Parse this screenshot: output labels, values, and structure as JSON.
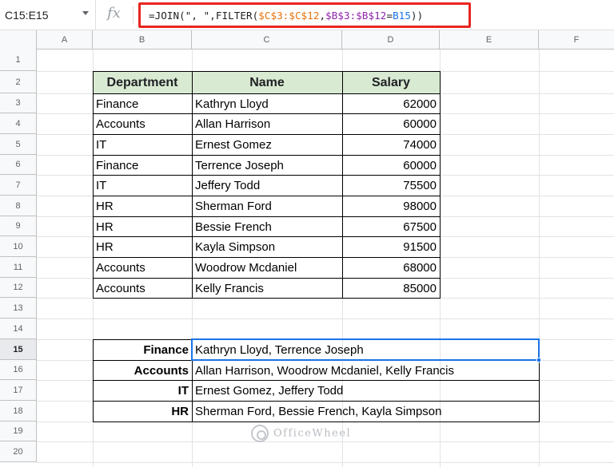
{
  "name_box": "C15:E15",
  "fx_symbol": "fx",
  "formula": {
    "p1": "=JOIN(\", \",FILTER(",
    "r1": "$C$3:$C$12",
    "p2": ",",
    "r2": "$B$3:$B$12",
    "p3": "=",
    "r3": "B15",
    "p4": "))"
  },
  "columns": [
    "A",
    "B",
    "C",
    "D",
    "E",
    "F"
  ],
  "rows": [
    "1",
    "2",
    "3",
    "4",
    "5",
    "6",
    "7",
    "8",
    "9",
    "10",
    "11",
    "12",
    "13",
    "14",
    "15",
    "16",
    "17",
    "18",
    "19",
    "20"
  ],
  "table1": {
    "headers": [
      "Department",
      "Name",
      "Salary"
    ],
    "rows": [
      [
        "Finance",
        "Kathryn Lloyd",
        "62000"
      ],
      [
        "Accounts",
        "Allan Harrison",
        "60000"
      ],
      [
        "IT",
        "Ernest Gomez",
        "74000"
      ],
      [
        "Finance",
        "Terrence Joseph",
        "60000"
      ],
      [
        "IT",
        "Jeffery Todd",
        "75500"
      ],
      [
        "HR",
        "Sherman Ford",
        "98000"
      ],
      [
        "HR",
        "Bessie French",
        "67500"
      ],
      [
        "HR",
        "Kayla Simpson",
        "91500"
      ],
      [
        "Accounts",
        "Woodrow Mcdaniel",
        "68000"
      ],
      [
        "Accounts",
        "Kelly Francis",
        "85000"
      ]
    ]
  },
  "table2": {
    "rows": [
      [
        "Finance",
        "Kathryn Lloyd, Terrence Joseph"
      ],
      [
        "Accounts",
        "Allan Harrison, Woodrow Mcdaniel, Kelly Francis"
      ],
      [
        "IT",
        "Ernest Gomez, Jeffery Todd"
      ],
      [
        "HR",
        "Sherman Ford, Bessie French, Kayla Simpson"
      ]
    ]
  },
  "watermark": "OfficeWheel"
}
